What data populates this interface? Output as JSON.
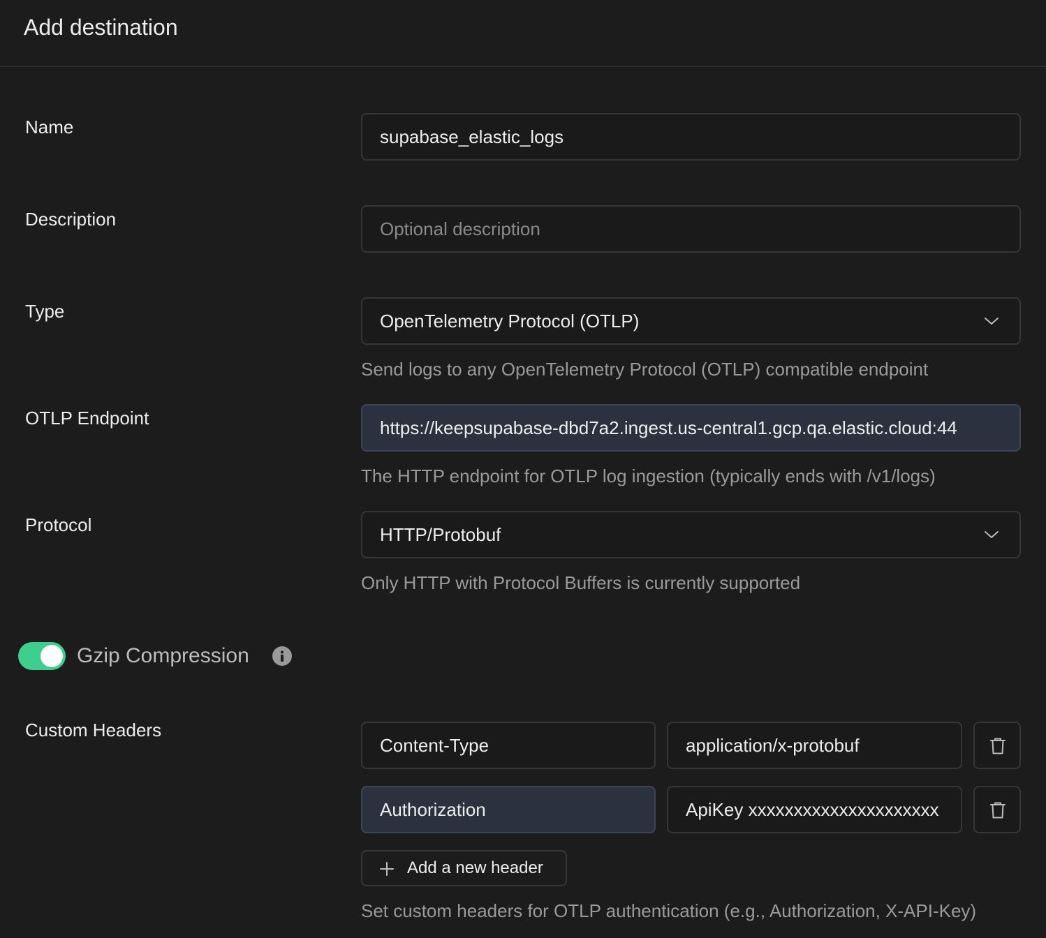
{
  "dialog": {
    "title": "Add destination"
  },
  "fields": {
    "name": {
      "label": "Name",
      "value": "supabase_elastic_logs"
    },
    "description": {
      "label": "Description",
      "placeholder": "Optional description"
    },
    "type": {
      "label": "Type",
      "value": "OpenTelemetry Protocol (OTLP)",
      "help": "Send logs to any OpenTelemetry Protocol (OTLP) compatible endpoint",
      "icon": "chevron-down-icon"
    },
    "endpoint": {
      "label": "OTLP Endpoint",
      "value": "https://keepsupabase-dbd7a2.ingest.us-central1.gcp.qa.elastic.cloud:44",
      "help": "The HTTP endpoint for OTLP log ingestion (typically ends with /v1/logs)"
    },
    "protocol": {
      "label": "Protocol",
      "value": "HTTP/Protobuf",
      "help": "Only HTTP with Protocol Buffers is currently supported",
      "icon": "chevron-down-icon"
    }
  },
  "gzip": {
    "label": "Gzip Compression",
    "enabled": true,
    "accent": "#3ecf8e",
    "icon": "info-icon"
  },
  "custom_headers": {
    "label": "Custom Headers",
    "rows": [
      {
        "key": "Content-Type",
        "value": "application/x-protobuf"
      },
      {
        "key": "Authorization",
        "value": "ApiKey xxxxxxxxxxxxxxxxxxxxx"
      }
    ],
    "add_label": "Add a new header",
    "help": "Set custom headers for OTLP authentication (e.g., Authorization, X-API-Key)"
  }
}
